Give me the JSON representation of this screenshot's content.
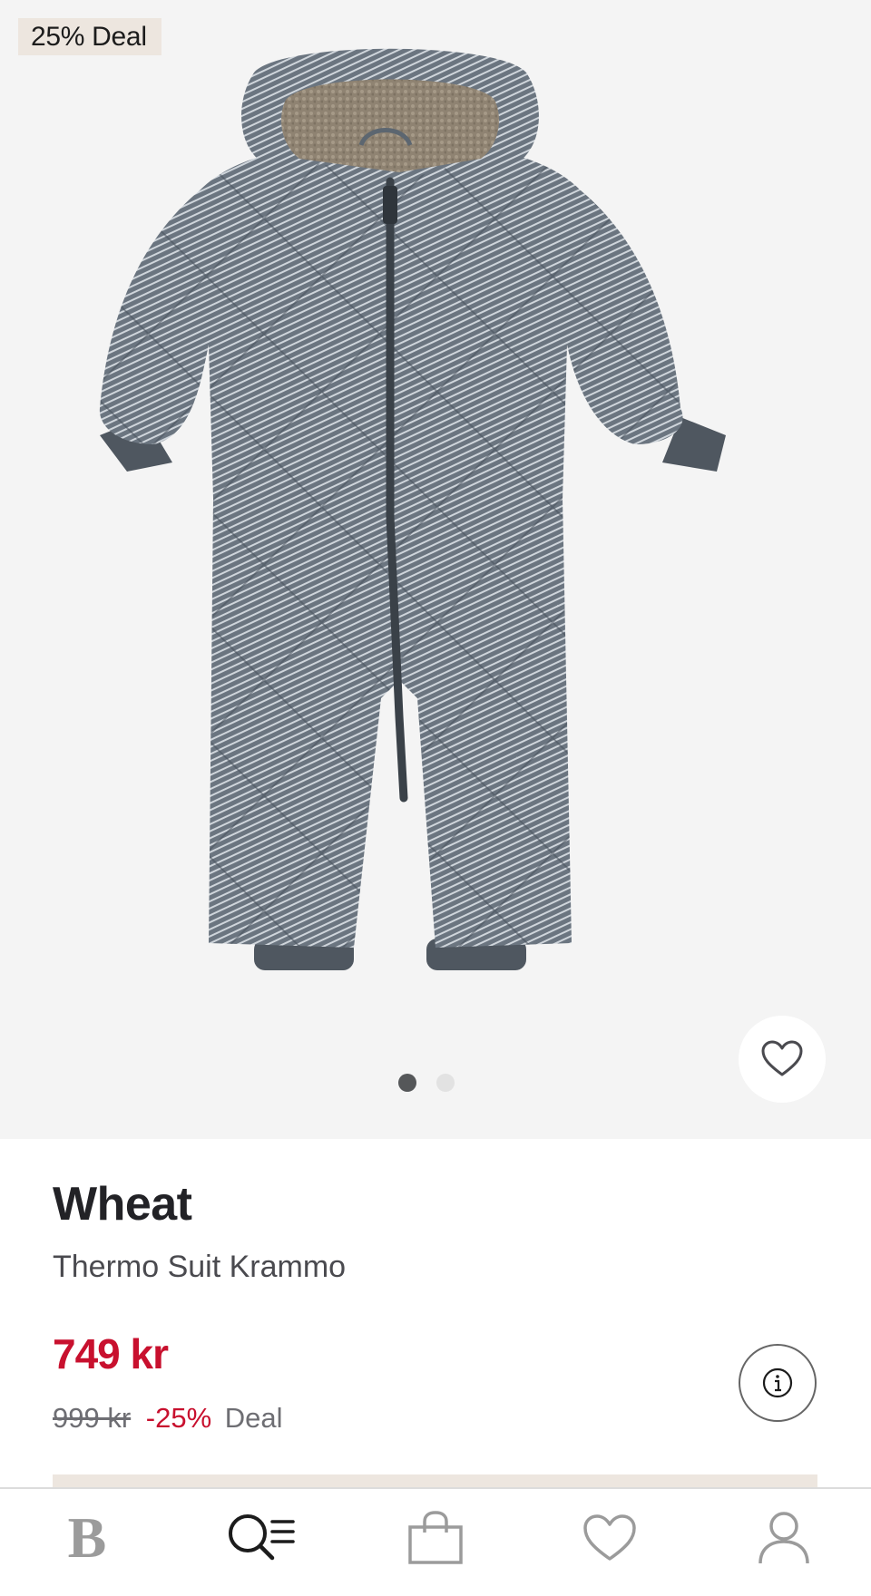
{
  "gallery": {
    "badge": "25% Deal",
    "image_alt": "Grey quilted striped baby thermo suit with hood and fleece lining",
    "current_image": 1,
    "image_count": 2
  },
  "product": {
    "brand": "Wheat",
    "name": "Thermo Suit Krammo",
    "price": "749 kr",
    "old_price": "999 kr",
    "discount": "-25%",
    "deal_label": "Deal"
  },
  "tabbar": {
    "logo": "B",
    "items": [
      "home",
      "search",
      "cart",
      "favorites",
      "account"
    ]
  },
  "colors": {
    "accent_red": "#c8102e",
    "badge_bg": "#ede6df",
    "text_dark": "#222226",
    "text_muted": "#6e6e73",
    "icon_grey": "#9b9b9b"
  },
  "icons": {
    "favorite": "heart-icon",
    "info": "info-icon",
    "search": "search-list-icon",
    "cart": "shopping-bag-icon",
    "wishlist": "heart-icon",
    "account": "user-icon"
  }
}
